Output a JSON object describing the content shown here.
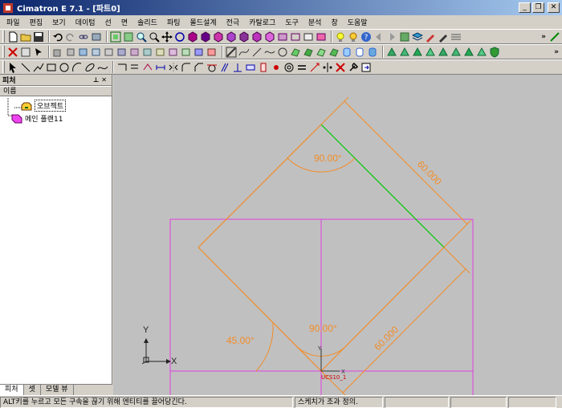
{
  "window": {
    "title": "Cimatron E 7.1 - [파트0]",
    "controls": [
      "_",
      "❐",
      "✕"
    ]
  },
  "menu": [
    "파일",
    "편집",
    "보기",
    "데이텀",
    "선",
    "면",
    "솔리드",
    "파팅",
    "몰드설계",
    "전극",
    "카탈로그",
    "도구",
    "분석",
    "창",
    "도움말"
  ],
  "panel": {
    "title": "피처",
    "column": "이름",
    "tree": [
      {
        "label": "오브젝트",
        "icon": "object-icon"
      },
      {
        "label": "메인 플랜11",
        "icon": "plane-icon"
      }
    ],
    "tabs": [
      "피처",
      "셋",
      "모델 뷰"
    ]
  },
  "viewport": {
    "dims": {
      "angle_top": "90.00°",
      "angle_bottom": "90.00°",
      "angle_left": "45.00°",
      "len_upper_right": "60.000",
      "len_lower_right": "60.000"
    },
    "axis_x": "X",
    "axis_y": "Y",
    "ucs_label": "UCS10_1",
    "small_x": "X",
    "small_y": "Y"
  },
  "status": {
    "hint": "ALT키를 누르고 모든 구속을 끊기 위해 엔티티를 끌어당긴다.",
    "state": "스케치가 조과 정의."
  },
  "colors": {
    "sketch": "#f28c28",
    "frame": "#e040e0",
    "highlight": "#00c800",
    "dim": "#f28c28"
  }
}
